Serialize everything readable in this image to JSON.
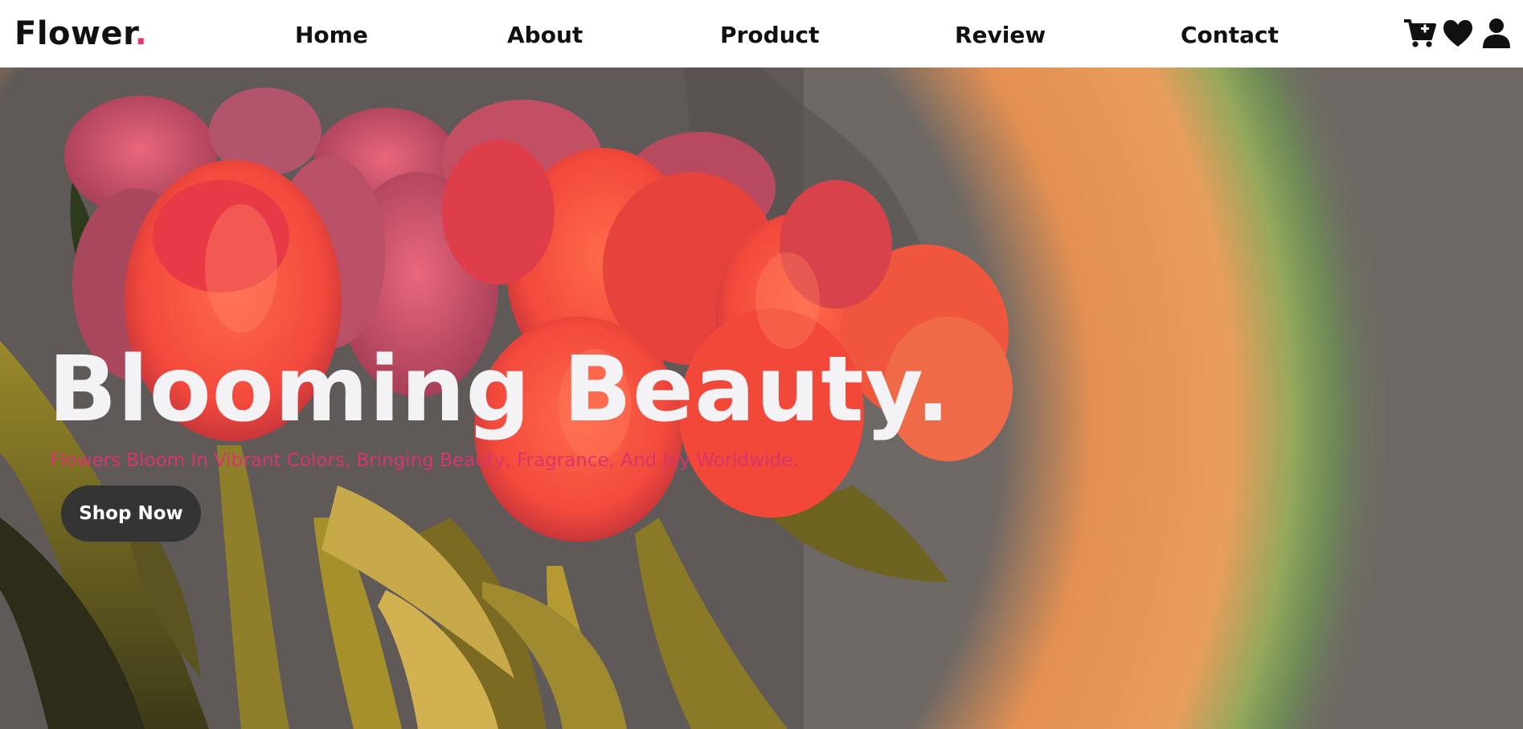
{
  "brand": {
    "name": "Flower",
    "dot": ".",
    "accent_color": "#e8386a"
  },
  "nav": {
    "links": [
      {
        "label": "Home"
      },
      {
        "label": "About"
      },
      {
        "label": "Product"
      },
      {
        "label": "Review"
      },
      {
        "label": "Contact"
      }
    ],
    "icons": [
      "cart-plus-icon",
      "heart-icon",
      "user-icon"
    ]
  },
  "hero": {
    "title": "Blooming Beauty.",
    "subtitle": "Flowers Bloom In Vibrant Colors, Bringing Beauty, Fragrance, And Joy Worldwide.",
    "cta_label": "Shop Now",
    "title_color": "#f3f3f5",
    "subtitle_color": "#d8366b",
    "button_color": "#343434"
  }
}
